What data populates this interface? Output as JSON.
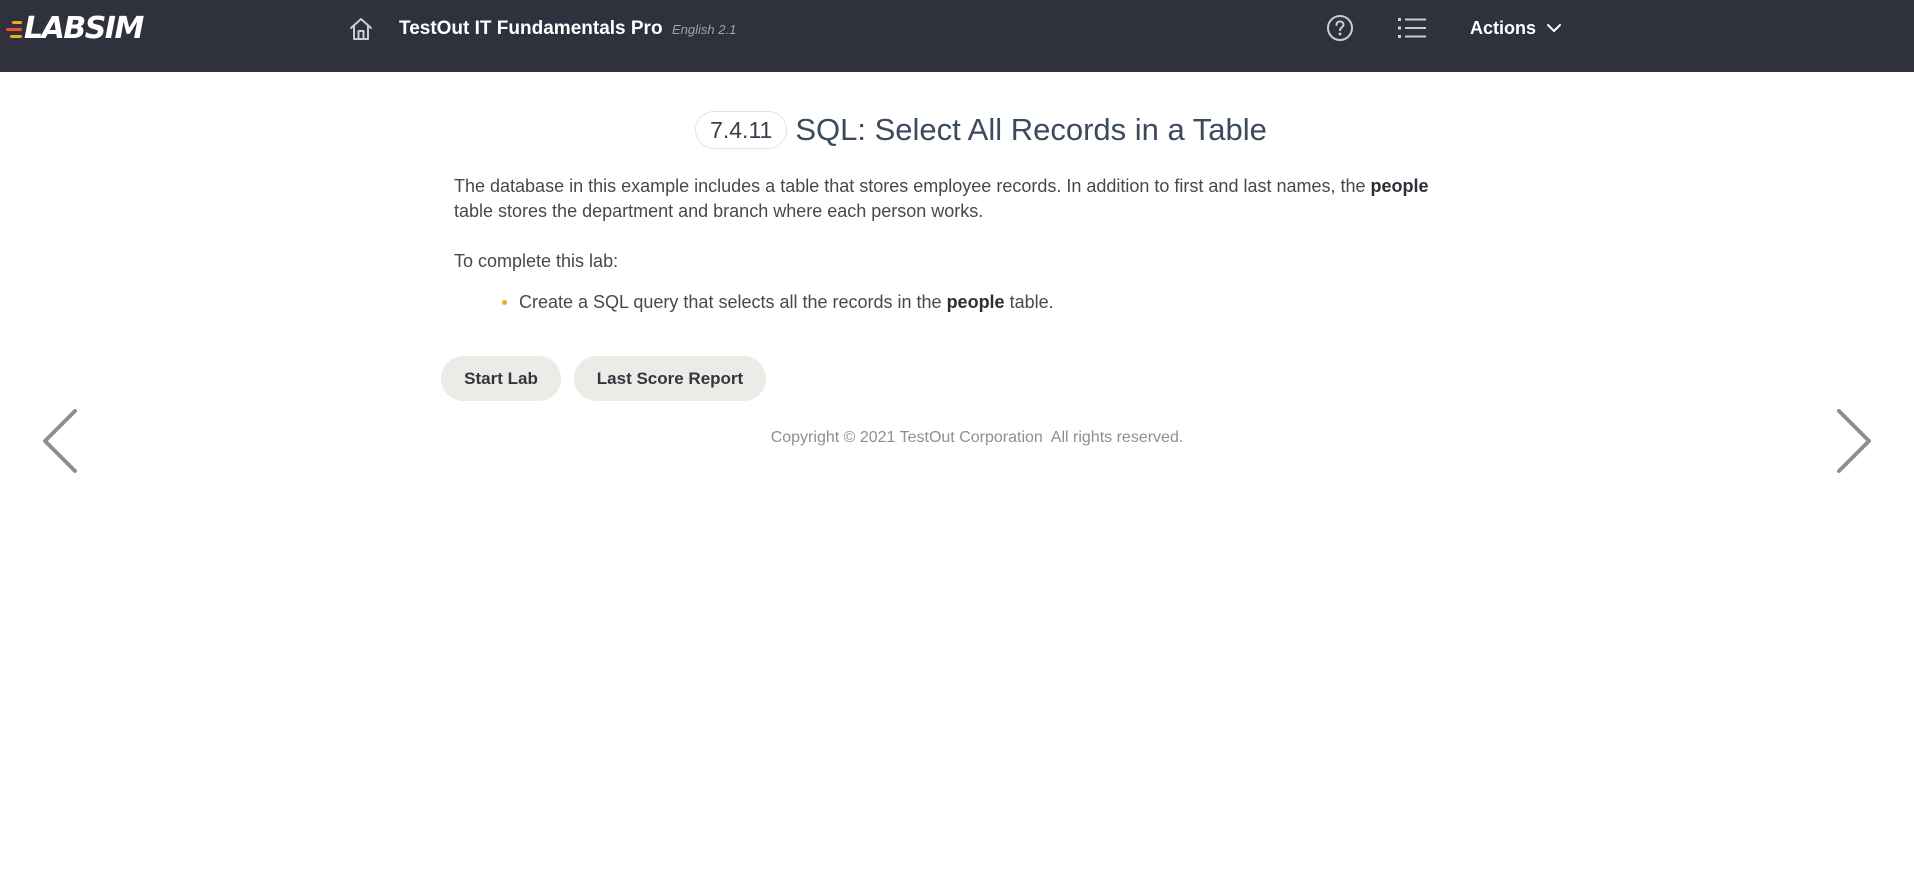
{
  "header": {
    "logo_text": "LABSIM",
    "course_title": "TestOut IT Fundamentals Pro",
    "course_version": "English 2.1",
    "actions_label": "Actions",
    "icons": {
      "home": "home-icon",
      "help": "help-circle-icon",
      "outline": "list-icon",
      "actions_chevron": "chevron-down-icon"
    },
    "colors": {
      "background": "#2f323d",
      "logo_stripe_1": "#f5a623",
      "logo_stripe_2": "#e8542e",
      "logo_stripe_3": "#f5a623"
    }
  },
  "lab": {
    "section_number": "7.4.11",
    "title": "SQL: Select All Records in a Table",
    "intro_part1": "The database in this example includes a table that stores employee records. In addition to first and last names, the ",
    "intro_bold": "people",
    "intro_part2": " table stores the department and branch where each person works.",
    "instructions_heading": "To complete this lab:",
    "tasks": [
      {
        "text_before": "Create a SQL query that selects all the records in the ",
        "bold": "people",
        "text_after": " table."
      }
    ],
    "bullet_color": "#f5a623"
  },
  "buttons": {
    "start_lab": "Start Lab",
    "last_score_report": "Last Score Report"
  },
  "footer": {
    "copyright": "Copyright © 2021 TestOut Corporation  All rights reserved."
  },
  "navigation": {
    "previous": "chevron-left-icon",
    "next": "chevron-right-icon"
  }
}
